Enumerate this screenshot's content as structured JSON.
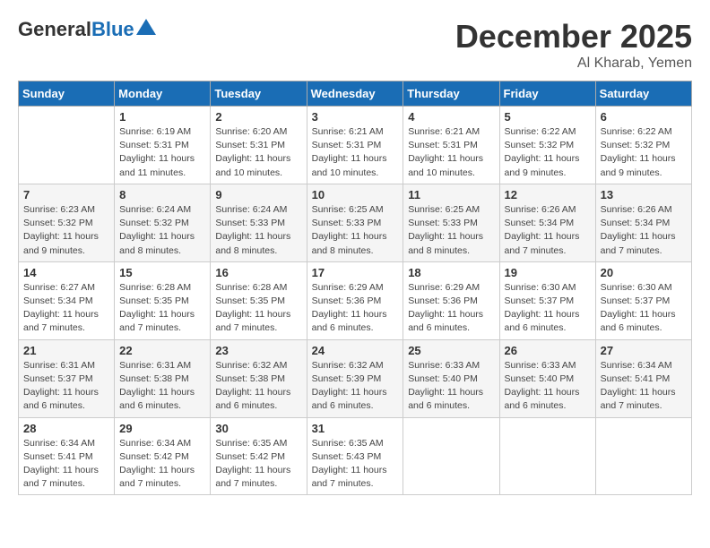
{
  "header": {
    "logo_general": "General",
    "logo_blue": "Blue",
    "month": "December 2025",
    "location": "Al Kharab, Yemen"
  },
  "days_of_week": [
    "Sunday",
    "Monday",
    "Tuesday",
    "Wednesday",
    "Thursday",
    "Friday",
    "Saturday"
  ],
  "weeks": [
    [
      {
        "num": "",
        "info": ""
      },
      {
        "num": "1",
        "info": "Sunrise: 6:19 AM\nSunset: 5:31 PM\nDaylight: 11 hours\nand 11 minutes."
      },
      {
        "num": "2",
        "info": "Sunrise: 6:20 AM\nSunset: 5:31 PM\nDaylight: 11 hours\nand 10 minutes."
      },
      {
        "num": "3",
        "info": "Sunrise: 6:21 AM\nSunset: 5:31 PM\nDaylight: 11 hours\nand 10 minutes."
      },
      {
        "num": "4",
        "info": "Sunrise: 6:21 AM\nSunset: 5:31 PM\nDaylight: 11 hours\nand 10 minutes."
      },
      {
        "num": "5",
        "info": "Sunrise: 6:22 AM\nSunset: 5:32 PM\nDaylight: 11 hours\nand 9 minutes."
      },
      {
        "num": "6",
        "info": "Sunrise: 6:22 AM\nSunset: 5:32 PM\nDaylight: 11 hours\nand 9 minutes."
      }
    ],
    [
      {
        "num": "7",
        "info": "Sunrise: 6:23 AM\nSunset: 5:32 PM\nDaylight: 11 hours\nand 9 minutes."
      },
      {
        "num": "8",
        "info": "Sunrise: 6:24 AM\nSunset: 5:32 PM\nDaylight: 11 hours\nand 8 minutes."
      },
      {
        "num": "9",
        "info": "Sunrise: 6:24 AM\nSunset: 5:33 PM\nDaylight: 11 hours\nand 8 minutes."
      },
      {
        "num": "10",
        "info": "Sunrise: 6:25 AM\nSunset: 5:33 PM\nDaylight: 11 hours\nand 8 minutes."
      },
      {
        "num": "11",
        "info": "Sunrise: 6:25 AM\nSunset: 5:33 PM\nDaylight: 11 hours\nand 8 minutes."
      },
      {
        "num": "12",
        "info": "Sunrise: 6:26 AM\nSunset: 5:34 PM\nDaylight: 11 hours\nand 7 minutes."
      },
      {
        "num": "13",
        "info": "Sunrise: 6:26 AM\nSunset: 5:34 PM\nDaylight: 11 hours\nand 7 minutes."
      }
    ],
    [
      {
        "num": "14",
        "info": "Sunrise: 6:27 AM\nSunset: 5:34 PM\nDaylight: 11 hours\nand 7 minutes."
      },
      {
        "num": "15",
        "info": "Sunrise: 6:28 AM\nSunset: 5:35 PM\nDaylight: 11 hours\nand 7 minutes."
      },
      {
        "num": "16",
        "info": "Sunrise: 6:28 AM\nSunset: 5:35 PM\nDaylight: 11 hours\nand 7 minutes."
      },
      {
        "num": "17",
        "info": "Sunrise: 6:29 AM\nSunset: 5:36 PM\nDaylight: 11 hours\nand 6 minutes."
      },
      {
        "num": "18",
        "info": "Sunrise: 6:29 AM\nSunset: 5:36 PM\nDaylight: 11 hours\nand 6 minutes."
      },
      {
        "num": "19",
        "info": "Sunrise: 6:30 AM\nSunset: 5:37 PM\nDaylight: 11 hours\nand 6 minutes."
      },
      {
        "num": "20",
        "info": "Sunrise: 6:30 AM\nSunset: 5:37 PM\nDaylight: 11 hours\nand 6 minutes."
      }
    ],
    [
      {
        "num": "21",
        "info": "Sunrise: 6:31 AM\nSunset: 5:37 PM\nDaylight: 11 hours\nand 6 minutes."
      },
      {
        "num": "22",
        "info": "Sunrise: 6:31 AM\nSunset: 5:38 PM\nDaylight: 11 hours\nand 6 minutes."
      },
      {
        "num": "23",
        "info": "Sunrise: 6:32 AM\nSunset: 5:38 PM\nDaylight: 11 hours\nand 6 minutes."
      },
      {
        "num": "24",
        "info": "Sunrise: 6:32 AM\nSunset: 5:39 PM\nDaylight: 11 hours\nand 6 minutes."
      },
      {
        "num": "25",
        "info": "Sunrise: 6:33 AM\nSunset: 5:40 PM\nDaylight: 11 hours\nand 6 minutes."
      },
      {
        "num": "26",
        "info": "Sunrise: 6:33 AM\nSunset: 5:40 PM\nDaylight: 11 hours\nand 6 minutes."
      },
      {
        "num": "27",
        "info": "Sunrise: 6:34 AM\nSunset: 5:41 PM\nDaylight: 11 hours\nand 7 minutes."
      }
    ],
    [
      {
        "num": "28",
        "info": "Sunrise: 6:34 AM\nSunset: 5:41 PM\nDaylight: 11 hours\nand 7 minutes."
      },
      {
        "num": "29",
        "info": "Sunrise: 6:34 AM\nSunset: 5:42 PM\nDaylight: 11 hours\nand 7 minutes."
      },
      {
        "num": "30",
        "info": "Sunrise: 6:35 AM\nSunset: 5:42 PM\nDaylight: 11 hours\nand 7 minutes."
      },
      {
        "num": "31",
        "info": "Sunrise: 6:35 AM\nSunset: 5:43 PM\nDaylight: 11 hours\nand 7 minutes."
      },
      {
        "num": "",
        "info": ""
      },
      {
        "num": "",
        "info": ""
      },
      {
        "num": "",
        "info": ""
      }
    ]
  ]
}
